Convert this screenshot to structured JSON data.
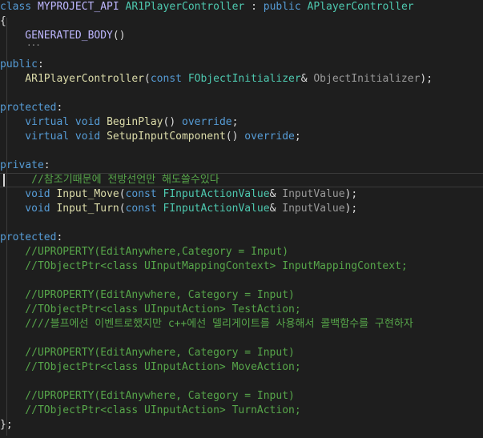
{
  "lines": [
    [
      [
        "class ",
        "#569cd6"
      ],
      [
        "MYPROJECT_API ",
        "#beb7ff"
      ],
      [
        "AR1PlayerController",
        "#4ec9b0"
      ],
      [
        " : ",
        "#dcdcdc"
      ],
      [
        "public ",
        "#569cd6"
      ],
      [
        "APlayerController",
        "#4ec9b0"
      ]
    ],
    [
      [
        "{",
        "#dcdcdc"
      ]
    ],
    [
      [
        "    GENERATED_BODY",
        "#beb7ff"
      ],
      [
        "()",
        "#dcdcdc"
      ]
    ],
    [],
    [
      [
        "public",
        "#569cd6"
      ],
      [
        ":",
        "#dcdcdc"
      ]
    ],
    [
      [
        "    AR1PlayerController",
        "#dcdcaa"
      ],
      [
        "(",
        "#dcdcdc"
      ],
      [
        "const ",
        "#569cd6"
      ],
      [
        "FObjectInitializer",
        "#4ec9b0"
      ],
      [
        "& ",
        "#dcdcdc"
      ],
      [
        "ObjectInitializer",
        "#9a9a9a"
      ],
      [
        ");",
        "#dcdcdc"
      ]
    ],
    [],
    [
      [
        "protected",
        "#569cd6"
      ],
      [
        ":",
        "#dcdcdc"
      ]
    ],
    [
      [
        "    virtual void ",
        "#569cd6"
      ],
      [
        "BeginPlay",
        "#dcdcaa"
      ],
      [
        "() ",
        "#dcdcdc"
      ],
      [
        "override",
        "#569cd6"
      ],
      [
        ";",
        "#dcdcdc"
      ]
    ],
    [
      [
        "    virtual void ",
        "#569cd6"
      ],
      [
        "SetupInputComponent",
        "#dcdcaa"
      ],
      [
        "() ",
        "#dcdcdc"
      ],
      [
        "override",
        "#569cd6"
      ],
      [
        ";",
        "#dcdcdc"
      ]
    ],
    [],
    [
      [
        "private",
        "#569cd6"
      ],
      [
        ":",
        "#dcdcdc"
      ]
    ],
    [
      [
        "     //참조기때문에 전방선언만 해도쓸수있다",
        "#57a64a"
      ]
    ],
    [
      [
        "    void ",
        "#569cd6"
      ],
      [
        "Input_Move",
        "#dcdcaa"
      ],
      [
        "(",
        "#dcdcdc"
      ],
      [
        "const ",
        "#569cd6"
      ],
      [
        "FInputActionValue",
        "#4ec9b0"
      ],
      [
        "& ",
        "#dcdcdc"
      ],
      [
        "InputValue",
        "#9a9a9a"
      ],
      [
        ");",
        "#dcdcdc"
      ]
    ],
    [
      [
        "    void ",
        "#569cd6"
      ],
      [
        "Input_Turn",
        "#dcdcaa"
      ],
      [
        "(",
        "#dcdcdc"
      ],
      [
        "const ",
        "#569cd6"
      ],
      [
        "FInputActionValue",
        "#4ec9b0"
      ],
      [
        "& ",
        "#dcdcdc"
      ],
      [
        "InputValue",
        "#9a9a9a"
      ],
      [
        ");",
        "#dcdcdc"
      ]
    ],
    [],
    [
      [
        "protected",
        "#569cd6"
      ],
      [
        ":",
        "#dcdcdc"
      ]
    ],
    [
      [
        "    //UPROPERTY(EditAnywhere,Category = Input)",
        "#57a64a"
      ]
    ],
    [
      [
        "    //TObjectPtr<class UInputMappingContext> InputMappingContext;",
        "#57a64a"
      ]
    ],
    [],
    [
      [
        "    //UPROPERTY(EditAnywhere, Category = Input)",
        "#57a64a"
      ]
    ],
    [
      [
        "    //TObjectPtr<class UInputAction> TestAction;",
        "#57a64a"
      ]
    ],
    [
      [
        "    ////블프에선 이벤트로했지만 c++에선 델리게이트를 사용해서 콜백함수를 구현하자",
        "#57a64a"
      ]
    ],
    [],
    [
      [
        "    //UPROPERTY(EditAnywhere, Category = Input)",
        "#57a64a"
      ]
    ],
    [
      [
        "    //TObjectPtr<class UInputAction> MoveAction;",
        "#57a64a"
      ]
    ],
    [],
    [
      [
        "    //UPROPERTY(EditAnywhere, Category = Input)",
        "#57a64a"
      ]
    ],
    [
      [
        "    //TObjectPtr<class UInputAction> TurnAction;",
        "#57a64a"
      ]
    ],
    [
      [
        "};",
        "#dcdcdc"
      ]
    ]
  ],
  "collapse_marker": "...",
  "current_line_index": 12
}
